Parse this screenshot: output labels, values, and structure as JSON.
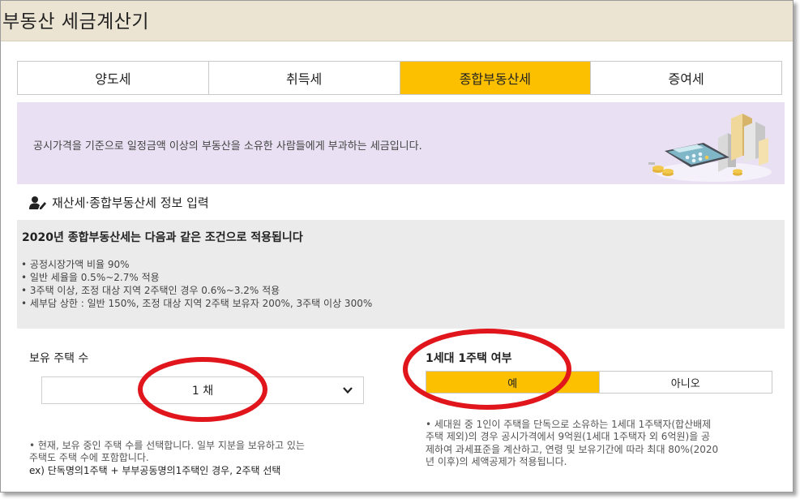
{
  "window": {
    "title": "부동산 세금계산기"
  },
  "tabs": [
    {
      "label": "양도세",
      "active": false
    },
    {
      "label": "취득세",
      "active": false
    },
    {
      "label": "종합부동산세",
      "active": true
    },
    {
      "label": "증여세",
      "active": false
    }
  ],
  "banner": {
    "text": "공시가격을 기준으로 일정금액 이상의 부동산을 소유한 사람들에게 부과하는 세금입니다."
  },
  "section": {
    "title": "재산세·종합부동산세 정보 입력"
  },
  "info": {
    "title": "2020년 종합부동산세는 다음과 같은 조건으로 적용됩니다",
    "items": [
      "공정시장가액 비율 90%",
      "일반 세율을 0.5%~2.7% 적용",
      "3주택 이상, 조정 대상 지역 2주택인 경우 0.6%~3.2% 적용",
      "세부담 상한 : 일반 150%, 조정 대상 지역 2주택 보유자 200%, 3주택 이상 300%"
    ]
  },
  "houses": {
    "label": "보유 주택 수",
    "selected": "1 채",
    "note_line1": "• 현재, 보유 중인 주택 수를 선택합니다. 일부 지분을 보유하고 있는",
    "note_line2": "주택도 주택 수에 포함합니다.",
    "example": "ex) 단독명의1주택 + 부부공동명의1주택인 경우, 2주택 선택"
  },
  "one_household": {
    "label": "1세대 1주택 여부",
    "yes": "예",
    "no": "아니오",
    "selected": "예",
    "note_line1": "• 세대원 중 1인이 주택을 단독으로 소유하는 1세대 1주택자(합산배제",
    "note_line2": "주택 제외)의 경우 공시가격에서 9억원(1세대 1주택자 외 6억원)을 공",
    "note_line3": "제하여 과세표준을 계산하고, 연령 및 보유기간에 따라 최대 80%(2020",
    "note_line4": "년 이후)의 세액공제가 적용됩니다."
  },
  "colors": {
    "accent": "#fcc000",
    "banner_bg": "#e9e1f3",
    "info_bg": "#ebebeb",
    "annotation": "#e0161c"
  },
  "icons": {
    "section": "user-edit-icon",
    "dropdown": "chevron-down-icon",
    "banner": "calculator-buildings-illustration"
  }
}
